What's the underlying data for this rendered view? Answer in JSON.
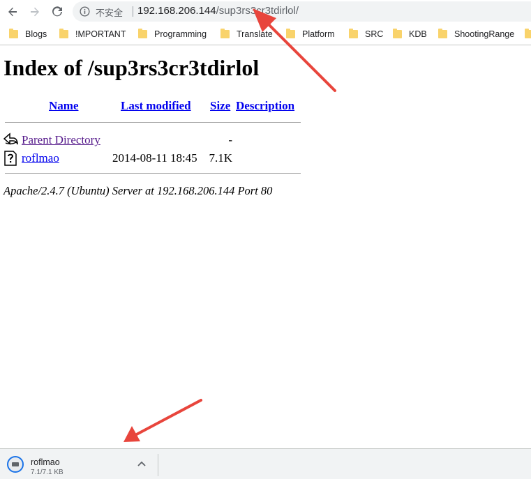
{
  "browser": {
    "security_label": "不安全",
    "url_host": "192.168.206.144",
    "url_path": "/sup3rs3cr3tdirlol/",
    "icons": {
      "back": "arrow-left-icon",
      "forward": "arrow-right-icon",
      "reload": "reload-icon",
      "site_info": "info-circle-icon"
    }
  },
  "bookmarks": [
    {
      "label": "Blogs"
    },
    {
      "label": "!MPORTANT"
    },
    {
      "label": "Programming"
    },
    {
      "label": "Translate"
    },
    {
      "label": "Platform"
    },
    {
      "label": "SRC"
    },
    {
      "label": "KDB"
    },
    {
      "label": "ShootingRange"
    }
  ],
  "page": {
    "title": "Index of /sup3rs3cr3tdirlol",
    "columns": {
      "name": "Name",
      "modified": "Last modified",
      "size": "Size",
      "description": "Description"
    },
    "rows": [
      {
        "name": "Parent Directory",
        "modified": "",
        "size": "-",
        "icon": "back-arrow-icon"
      },
      {
        "name": "roflmao",
        "modified": "2014-08-11 18:45",
        "size": "7.1K",
        "icon": "unknown-file-icon"
      }
    ],
    "address": "Apache/2.4.7 (Ubuntu) Server at 192.168.206.144 Port 80"
  },
  "download": {
    "filename": "roflmao",
    "progress": "7.1/7.1 KB"
  },
  "colors": {
    "link": "#0000ee",
    "visited": "#551a8b",
    "annotation_arrow": "#e8453c"
  }
}
